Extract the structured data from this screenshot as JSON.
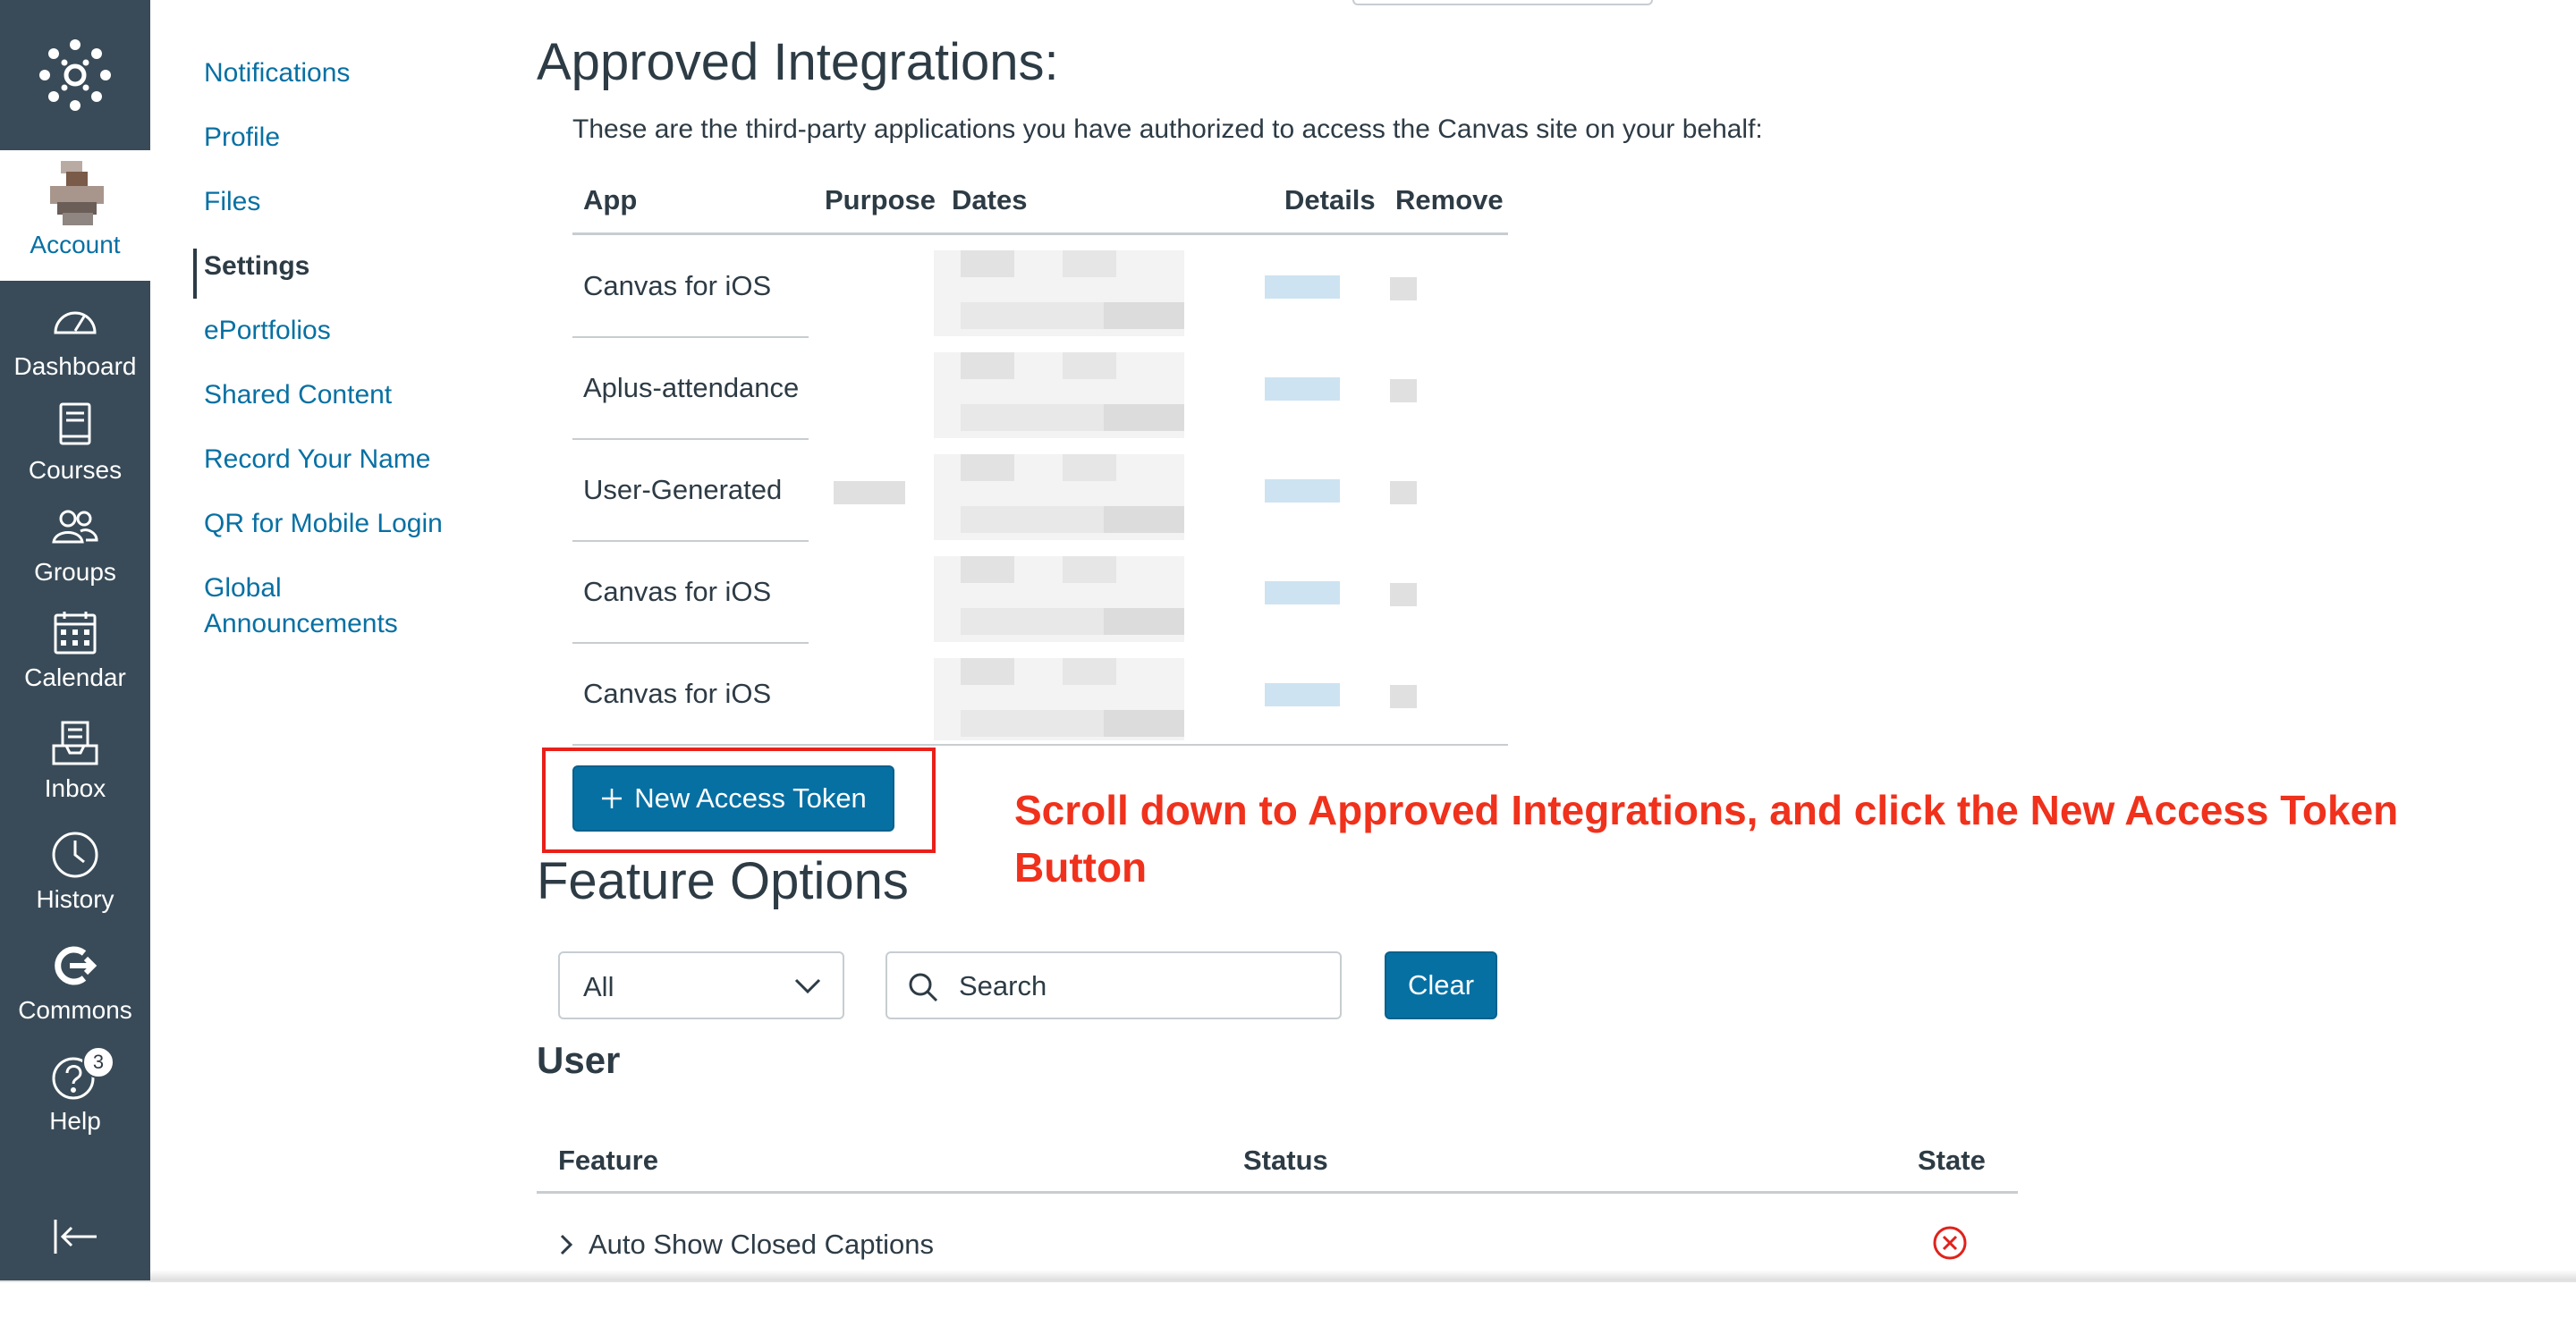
{
  "nav": {
    "account_label": "Account",
    "items": [
      {
        "label": "Dashboard",
        "icon": "dashboard-icon"
      },
      {
        "label": "Courses",
        "icon": "courses-icon"
      },
      {
        "label": "Groups",
        "icon": "groups-icon"
      },
      {
        "label": "Calendar",
        "icon": "calendar-icon"
      },
      {
        "label": "Inbox",
        "icon": "inbox-icon"
      },
      {
        "label": "History",
        "icon": "history-icon"
      },
      {
        "label": "Commons",
        "icon": "commons-icon"
      },
      {
        "label": "Help",
        "icon": "help-icon",
        "badge": "3"
      }
    ],
    "colors": {
      "background": "#394b58",
      "link": "#0770a3"
    }
  },
  "submenu": {
    "items": [
      "Notifications",
      "Profile",
      "Files",
      "Settings",
      "ePortfolios",
      "Shared Content",
      "Record Your Name",
      "QR for Mobile Login",
      "Global",
      "Announcements"
    ],
    "active": "Settings"
  },
  "integrations": {
    "title": "Approved Integrations:",
    "intro": "These are the third-party applications you have authorized to access the Canvas site on your behalf:",
    "columns": [
      "App",
      "Purpose",
      "Dates",
      "Details",
      "Remove"
    ],
    "rows": [
      {
        "app": "Canvas for iOS"
      },
      {
        "app": "Aplus-attendance"
      },
      {
        "app": "User-Generated"
      },
      {
        "app": "Canvas for iOS"
      },
      {
        "app": "Canvas for iOS"
      }
    ],
    "new_token_label": "New Access Token"
  },
  "annotation": {
    "text": "Scroll down to Approved Integrations, and click the New Access Token Button",
    "color": "#f0311c"
  },
  "features": {
    "title": "Feature Options",
    "filter_value": "All",
    "search_placeholder": "Search",
    "clear_label": "Clear",
    "section": "User",
    "columns": [
      "Feature",
      "Status",
      "State"
    ],
    "rows": [
      {
        "name": "Auto Show Closed Captions",
        "state": "disabled"
      }
    ]
  }
}
